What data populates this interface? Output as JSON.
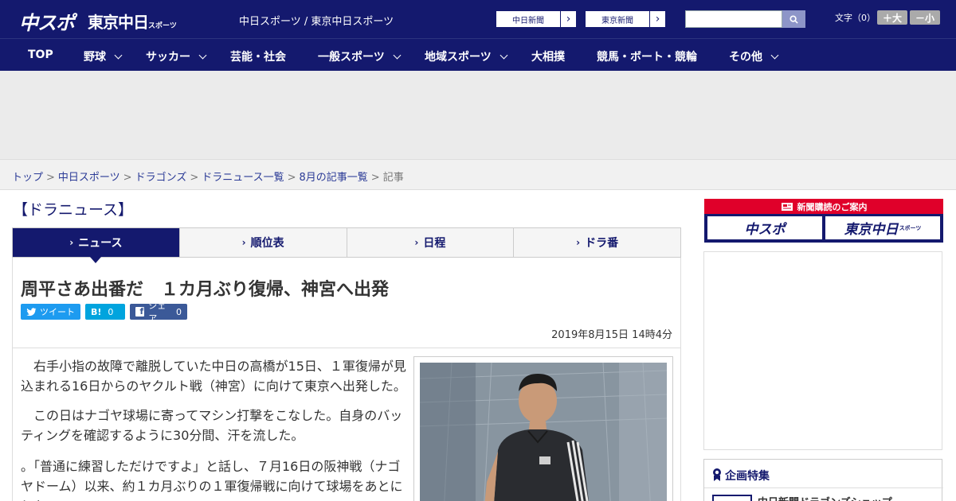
{
  "header": {
    "logo_chuspo": "中スポ",
    "logo_tokyo": "東京中日",
    "logo_tokyo_suffix": "スポーツ",
    "site_name": "中日スポーツ / 東京中日スポーツ",
    "ext_links": [
      "中日新聞",
      "東京新聞"
    ],
    "search": {
      "placeholder": ""
    },
    "font_size_label": "文字（0）",
    "size_up": "＋大",
    "size_down": "－小"
  },
  "nav": {
    "items": [
      {
        "label": "TOP",
        "has_dropdown": false
      },
      {
        "label": "野球",
        "has_dropdown": true
      },
      {
        "label": "サッカー",
        "has_dropdown": true
      },
      {
        "label": "芸能・社会",
        "has_dropdown": false
      },
      {
        "label": "一般スポーツ",
        "has_dropdown": true
      },
      {
        "label": "地域スポーツ",
        "has_dropdown": true
      },
      {
        "label": "大相撲",
        "has_dropdown": false
      },
      {
        "label": "競馬・ボート・競輪",
        "has_dropdown": false
      },
      {
        "label": "その他",
        "has_dropdown": true
      }
    ]
  },
  "breadcrumb": {
    "items": [
      "トップ",
      "中日スポーツ",
      "ドラゴンズ",
      "ドラニュース一覧",
      "8月の記事一覧"
    ],
    "current": "記事",
    "separator": ">"
  },
  "section_title": "【ドラニュース】",
  "tabs": [
    {
      "label": "ニュース",
      "active": true
    },
    {
      "label": "順位表",
      "active": false
    },
    {
      "label": "日程",
      "active": false
    },
    {
      "label": "ドラ番",
      "active": false
    }
  ],
  "article": {
    "headline": "周平さあ出番だ　１カ月ぶり復帰、神宮へ出発",
    "share": {
      "tweet": "ツイート",
      "hatena_label": "B!",
      "hatena_count": "0",
      "facebook": "シェア",
      "facebook_count": "0"
    },
    "date": "2019年8月15日 14時4分",
    "paragraphs": [
      "　右手小指の故障で離脱していた中日の高橋が15日、１軍復帰が見込まれる16日からのヤクルト戦（神宮）に向けて東京へ出発した。",
      "　この日はナゴヤ球場に寄ってマシン打撃をこなした。自身のバッティングを確認するように30分間、汗を流した。",
      "。「普通に練習しただけですよ」と話し、７月16日の阪神戦（ナゴヤドーム）以来、約１カ月ぶりの１軍復帰戦に向けて球場をあとにした。"
    ]
  },
  "sidebar": {
    "promo_title": "新聞購読のご案内",
    "promo_logos": [
      "中スポ",
      "東京中日"
    ],
    "promo_logo_suffix": "スポーツ",
    "feature_title": "企画特集",
    "feature_item": "中日新聞ドラゴンズショップ"
  },
  "colors": {
    "brand_navy": "#14196e",
    "promo_red": "#e0002a",
    "twitter": "#1d9bf0",
    "hatena": "#00a4de",
    "facebook": "#3b5998"
  }
}
